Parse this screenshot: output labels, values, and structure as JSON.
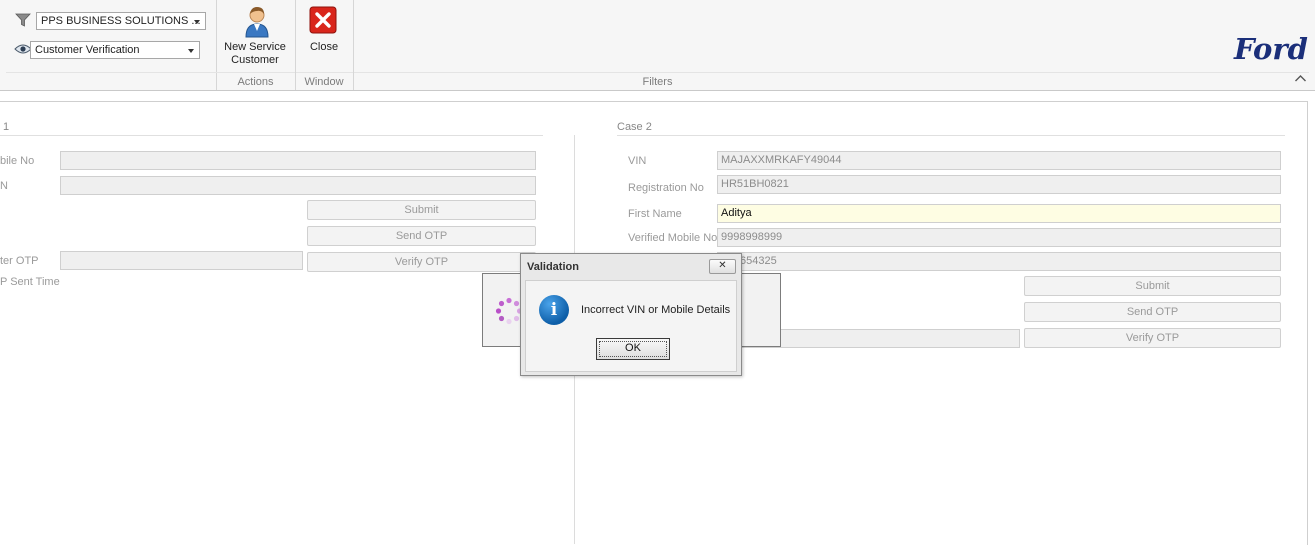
{
  "ribbon": {
    "filters": {
      "company_value": "PPS BUSINESS SOLUTIONS ...",
      "view_value": "Customer Verification",
      "caption": "Filters"
    },
    "actions": {
      "new_service_customer_line1": "New Service",
      "new_service_customer_line2": "Customer",
      "caption": "Actions"
    },
    "window": {
      "close_label": "Close",
      "caption": "Window"
    },
    "brand": "Ford"
  },
  "case1": {
    "title": "1",
    "labels": {
      "mobile": "bile No",
      "vin": "N",
      "enter_otp": "ter OTP",
      "otp_sent_time": "P Sent Time"
    },
    "buttons": {
      "submit": "Submit",
      "send_otp": "Send OTP",
      "verify_otp": "Verify OTP"
    }
  },
  "case2": {
    "title": "Case 2",
    "labels": {
      "vin": "VIN",
      "registration": "Registration No",
      "first_name": "First Name",
      "verified_mobile": "Verified Mobile No"
    },
    "values": {
      "vin": "MAJAXXMRKAFY49044",
      "registration": "HR51BH0821",
      "first_name": "Aditya",
      "verified_mobile": "9998998999",
      "partial_field": "654325"
    },
    "buttons": {
      "submit": "Submit",
      "send_otp": "Send OTP",
      "verify_otp": "Verify OTP"
    }
  },
  "dialog": {
    "title": "Validation",
    "close_glyph": "✕",
    "icon_glyph": "i",
    "message": "Incorrect VIN or Mobile Details",
    "ok_label": "OK"
  },
  "colors": {
    "active_field_bg": "#fefde3",
    "info_icon_blue": "#0d5ea8",
    "close_icon_red": "#d9261c",
    "ford_blue": "#1b2f7a",
    "spinner_violet": "#c86fd6"
  }
}
